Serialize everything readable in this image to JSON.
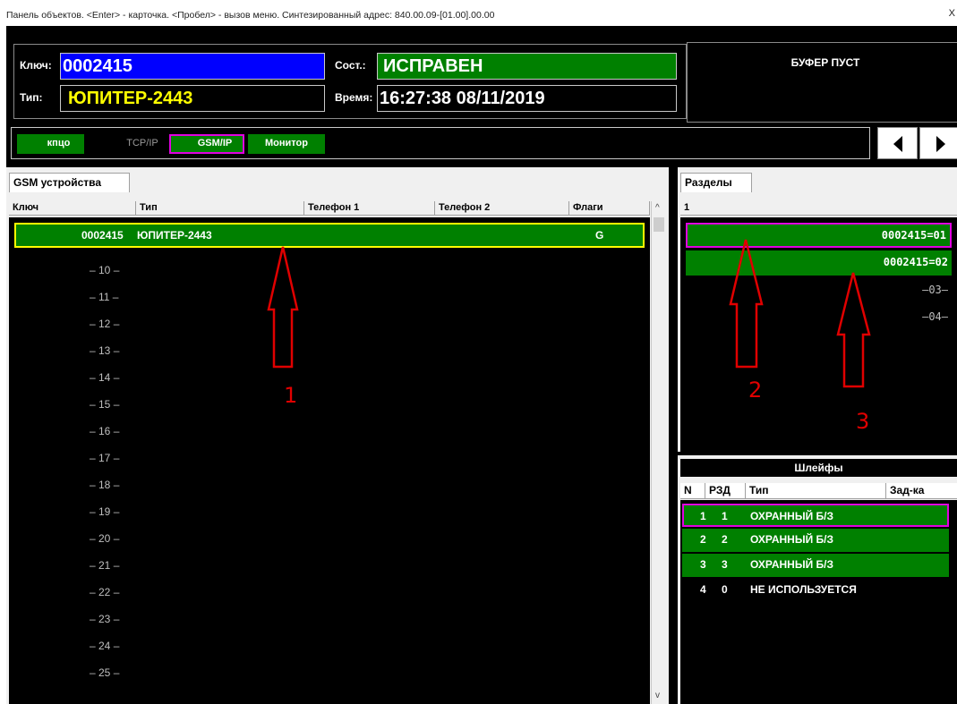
{
  "titlebar": {
    "text": "Панель объектов. <Enter> - карточка. <Пробел> - вызов меню. Синтезированный адрес: 840.00.09-[01.00].00.00",
    "close": "X"
  },
  "object": {
    "key_label": "Ключ:",
    "key_value": "0002415",
    "type_label": "Тип:",
    "type_value": "ЮПИТЕР-2443",
    "state_label": "Сост.:",
    "state_value": "ИСПРАВЕН",
    "time_label": "Время:",
    "time_value": "16:27:38 08/11/2019"
  },
  "buffer": {
    "text": "БУФЕР ПУСТ"
  },
  "modes": {
    "kpco": "кпцо",
    "tcp": "TCP/IP",
    "gsm": "GSM/IP",
    "monitor": "Монитор"
  },
  "gsm": {
    "tab": "GSM устройства",
    "columns": [
      "Ключ",
      "Тип",
      "Телефон 1",
      "Телефон 2",
      "Флаги"
    ],
    "selected_row": {
      "key": "0002415",
      "type": "ЮПИТЕР-2443",
      "phone1": "",
      "phone2": "",
      "flags": "G"
    },
    "empty_rows": [
      "– 10 –",
      "– 11 –",
      "– 12 –",
      "– 13 –",
      "– 14 –",
      "– 15 –",
      "– 16 –",
      "– 17 –",
      "– 18 –",
      "– 19 –",
      "– 20 –",
      "– 21 –",
      "– 22 –",
      "– 23 –",
      "– 24 –",
      "– 25 –"
    ]
  },
  "sections": {
    "tab": "Разделы",
    "column": "1",
    "rows": [
      "0002415=01",
      "0002415=02",
      "–03–",
      "–04–"
    ]
  },
  "loops": {
    "title": "Шлейфы",
    "columns": [
      "N",
      "РЗД",
      "Тип",
      "Зад-ка"
    ],
    "rows": [
      {
        "n": "1",
        "rzd": "1",
        "type": "ОХРАННЫЙ Б/З"
      },
      {
        "n": "2",
        "rzd": "2",
        "type": "ОХРАННЫЙ Б/З"
      },
      {
        "n": "3",
        "rzd": "3",
        "type": "ОХРАННЫЙ Б/З"
      },
      {
        "n": "4",
        "rzd": "0",
        "type": "НЕ ИСПОЛЬЗУЕТСЯ"
      }
    ]
  },
  "annotations": {
    "a1": "1",
    "a2": "2",
    "a3": "3"
  },
  "scroll": {
    "up": "^",
    "down": "v"
  },
  "colors": {
    "green": "#008000",
    "blue": "#0000ff",
    "yellow": "#ffff00",
    "magenta": "#e000e0",
    "annotation": "#e00000"
  }
}
